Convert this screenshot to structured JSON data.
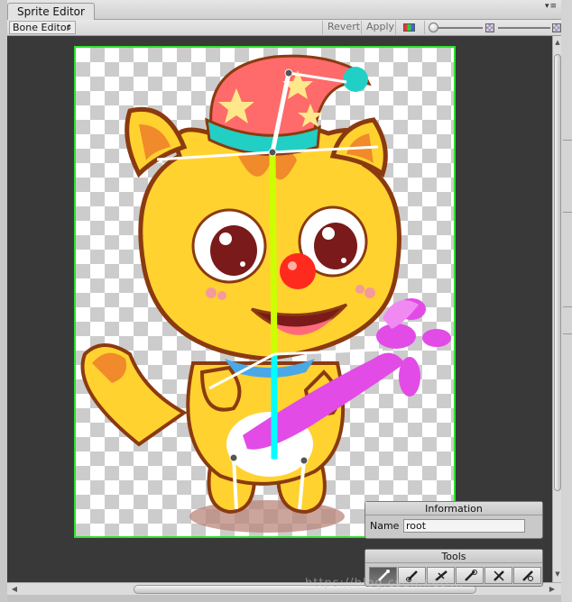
{
  "window": {
    "tab_title": "Sprite Editor"
  },
  "toolbar": {
    "mode_dropdown": "Bone Editor",
    "revert_label": "Revert",
    "apply_label": "Apply",
    "rgb_icon": "rgb-channel-icon",
    "alpha_icon": "alpha-checker-icon",
    "zoom_icon": "zoom-checker-icon"
  },
  "information": {
    "title": "Information",
    "name_label": "Name",
    "name_value": "root"
  },
  "tools": {
    "title": "Tools",
    "buttons": [
      "select-bone-icon",
      "create-bone-icon",
      "split-bone-icon",
      "free-bone-icon",
      "delete-bone-icon",
      "parent-bone-icon"
    ]
  },
  "watermark": "https://blog.csdn.net/...",
  "colors": {
    "sprite_border": "#2de12d",
    "cat_body": "#ffd230",
    "cat_outline": "#8b3a10",
    "hat": "#ff6a6a",
    "balloon": "#e24be6",
    "bone_yellow": "#ccff00",
    "bone_cyan": "#00ffff"
  }
}
